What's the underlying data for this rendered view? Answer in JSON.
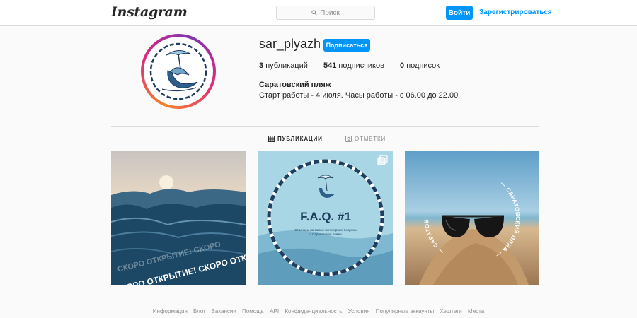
{
  "header": {
    "logo": "Instagram",
    "search_placeholder": "Поиск",
    "login_label": "Войти",
    "signup_label": "Зарегистрироваться"
  },
  "profile": {
    "username": "sar_plyazh",
    "follow_label": "Подписаться",
    "stats": [
      {
        "value": "3",
        "label": "публикаций"
      },
      {
        "value": "541",
        "label": "подписчиков"
      },
      {
        "value": "0",
        "label": "подписок"
      }
    ],
    "full_name": "Саратовский пляж",
    "bio": "Старт работы - 4 июля. Часы работы - с 06.00 до 22.00"
  },
  "tabs": [
    {
      "label": "ПУБЛИКАЦИИ",
      "icon": "grid-icon",
      "active": true
    },
    {
      "label": "ОТМЕТКИ",
      "icon": "tagged-icon",
      "active": false
    }
  ],
  "posts": [
    {
      "caption": "СКОРО ОТКРЫТИЕ! СКОРО ОТКРЫТИЕ!",
      "image": "sea-waves-photo"
    },
    {
      "title": "F.A.Q. #1",
      "subtitle_line1": "Отвечаем на самые популярные вопросы",
      "subtitle_line2": "о Саратовском пляже",
      "image": "faq-graphic",
      "badge": "carousel-icon"
    },
    {
      "ring_text": "— САРАТОВСКИЙ ПЛЯЖ —",
      "image": "sunglasses-sand-photo"
    }
  ],
  "footer": {
    "links": [
      "Информация",
      "Блог",
      "Вакансии",
      "Помощь",
      "API",
      "Конфиденциальность",
      "Условия",
      "Популярные аккаунты",
      "Хэштеги",
      "Места"
    ]
  }
}
